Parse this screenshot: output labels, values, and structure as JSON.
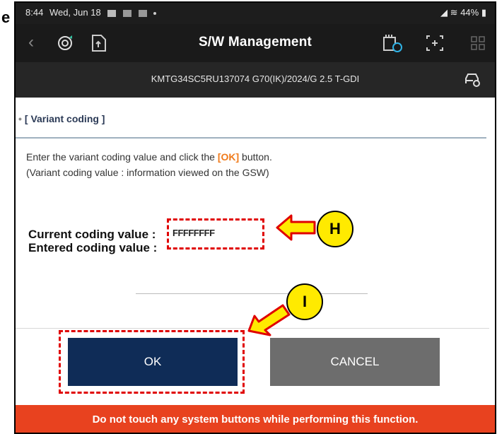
{
  "status_bar": {
    "time": "8:44",
    "date": "Wed, Jun 18",
    "battery": "44%"
  },
  "app_bar": {
    "title": "S/W Management",
    "icons": [
      "back-icon",
      "diagnostics-icon",
      "document-upload-icon",
      "vehicle-comm-icon",
      "screen-capture-icon",
      "grid-menu-icon"
    ]
  },
  "vehicle": {
    "info": "KMTG34SC5RU137074  G70(IK)/2024/G 2.5 T-GDI"
  },
  "section": {
    "title": "[ Variant coding ]",
    "instruction_pre": "Enter the variant coding value and click the ",
    "instruction_ok": "[OK]",
    "instruction_post": " button.",
    "instruction_line2": "(Variant coding value : information viewed on the GSW)"
  },
  "coding": {
    "current_label": "Current coding value :",
    "current_value": "FFFFFFFF",
    "entered_label": "Entered coding value :",
    "entered_value": ""
  },
  "buttons": {
    "ok": "OK",
    "cancel": "CANCEL"
  },
  "warning": "Do not touch any system buttons while performing this function.",
  "annotations": {
    "side_letter": "e",
    "callout_h": "H",
    "callout_i": "I"
  },
  "colors": {
    "ok_button": "#0f2c57",
    "cancel_button": "#6d6d6d",
    "warning_bar": "#e8421f",
    "highlight_ok": "#f07a1a",
    "callout_fill": "#ffea00",
    "annotation_red": "#e00000"
  }
}
